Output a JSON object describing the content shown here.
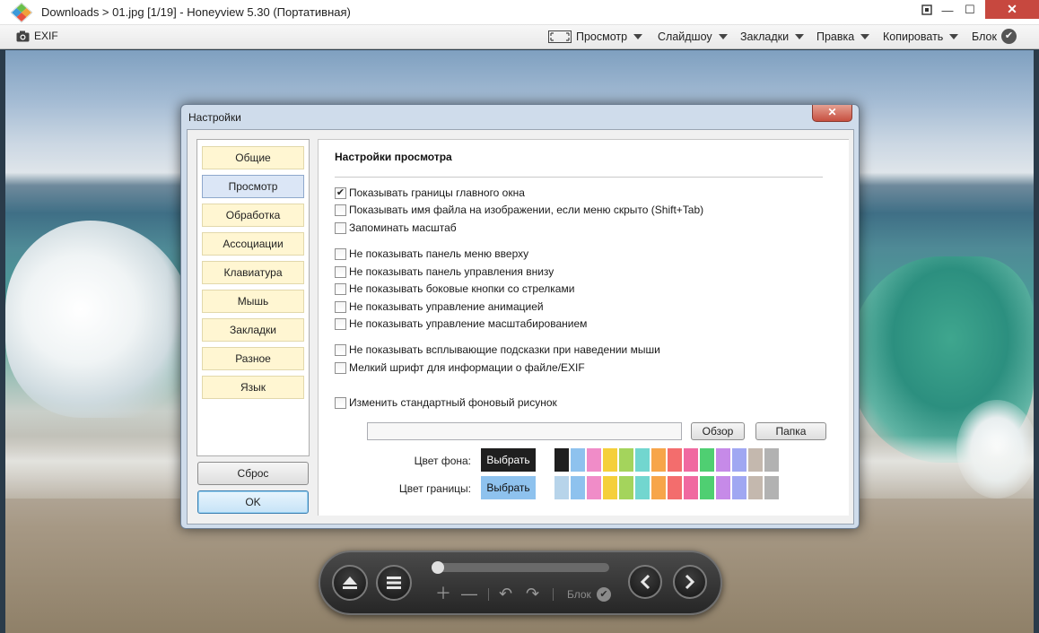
{
  "window": {
    "title": "Downloads > 01.jpg [1/19] - Honeyview 5.30 (Портативная)",
    "close_glyph": "✕",
    "min_glyph": "—",
    "max_glyph": "☐"
  },
  "menubar": {
    "exif_label": "EXIF",
    "items": [
      {
        "label": "Просмотр"
      },
      {
        "label": "Слайдшоу"
      },
      {
        "label": "Закладки"
      },
      {
        "label": "Правка"
      },
      {
        "label": "Копировать"
      }
    ],
    "lock_label": "Блок"
  },
  "dialog": {
    "title": "Настройки",
    "close_glyph": "✕",
    "nav": [
      "Общие",
      "Просмотр",
      "Обработка",
      "Ассоциации",
      "Клавиатура",
      "Мышь",
      "Закладки",
      "Разное",
      "Язык"
    ],
    "active_nav": "Просмотр",
    "reset_label": "Сброс",
    "ok_label": "OK",
    "section_title": "Настройки просмотра",
    "options": [
      {
        "label": "Показывать границы главного окна",
        "checked": true
      },
      {
        "label": "Показывать имя файла на изображении, если меню скрыто (Shift+Tab)",
        "checked": false
      },
      {
        "label": "Запоминать масштаб",
        "checked": false
      },
      {
        "label": "Не показывать панель меню вверху",
        "checked": false
      },
      {
        "label": "Не показывать панель управления внизу",
        "checked": false
      },
      {
        "label": "Не показывать боковые кнопки со стрелками",
        "checked": false
      },
      {
        "label": "Не показывать управление анимацией",
        "checked": false
      },
      {
        "label": "Не показывать управление масштабированием",
        "checked": false
      },
      {
        "label": "Не показывать всплывающие подсказки при наведении мыши",
        "checked": false
      },
      {
        "label": "Мелкий шрифт для информации о файле/EXIF",
        "checked": false
      },
      {
        "label": "Изменить стандартный фоновый рисунок",
        "checked": false
      }
    ],
    "background_path": "",
    "browse_label": "Обзор",
    "folder_label": "Папка",
    "bg_color_label": "Цвет фона:",
    "border_color_label": "Цвет границы:",
    "pick_label": "Выбрать",
    "bg_swatches": [
      "#1f1f1f",
      "#8ec2ee",
      "#f08cc8",
      "#f5cf3a",
      "#a4d45c",
      "#72d6cf",
      "#f7a54a",
      "#f36d6d",
      "#f069a0",
      "#4fcf72",
      "#c68ae8",
      "#a0a7f2",
      "#c4b8ae",
      "#b2b2b2"
    ],
    "border_swatches": [
      "#b7d4ea",
      "#8ec2ee",
      "#f08cc8",
      "#f5cf3a",
      "#a4d45c",
      "#72d6cf",
      "#f7a54a",
      "#f36d6d",
      "#f069a0",
      "#4fcf72",
      "#c68ae8",
      "#a0a7f2",
      "#c4b8ae",
      "#b2b2b2"
    ]
  },
  "controls": {
    "lock_label": "Блок",
    "progress": 0.0
  }
}
